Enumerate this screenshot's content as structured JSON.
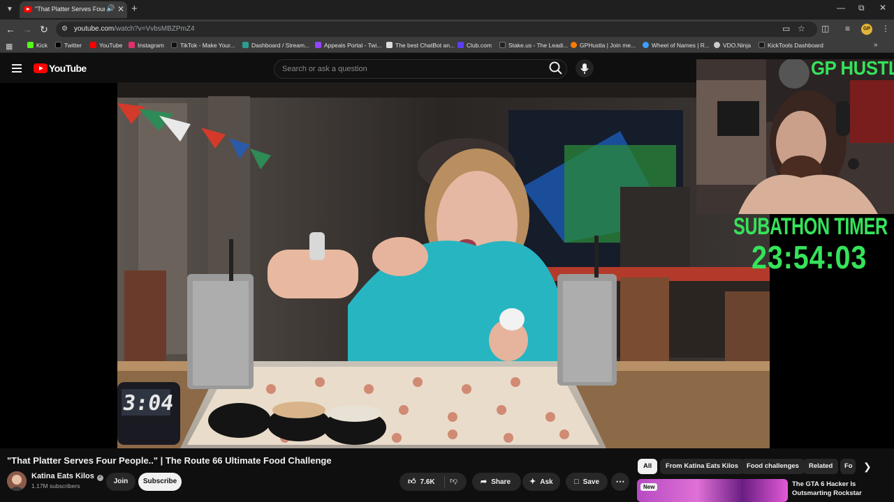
{
  "browser": {
    "tab_title": "\"That Platter Serves Four Pe",
    "url_host": "youtube.com",
    "url_path": "/watch?v=VvbsMBZPmZ4",
    "profile_initials": "GP",
    "bookmarks": [
      {
        "label": "Kick",
        "color": "#53fc18"
      },
      {
        "label": "Twitter",
        "color": "#000000"
      },
      {
        "label": "YouTube",
        "color": "#ff0000"
      },
      {
        "label": "Instagram",
        "color": "#e1306c"
      },
      {
        "label": "TikTok - Make Your...",
        "color": "#111111"
      },
      {
        "label": "Dashboard / Stream...",
        "color": "#2a9d8f"
      },
      {
        "label": "Appeals Portal - Twi...",
        "color": "#9146ff"
      },
      {
        "label": "The best ChatBot an...",
        "color": "#dddddd"
      },
      {
        "label": "Club.com",
        "color": "#5b3df5"
      },
      {
        "label": "Stake.us - The Leadi...",
        "color": "#222222"
      },
      {
        "label": "GPHustla | Join me...",
        "color": "#ff7a00"
      },
      {
        "label": "Wheel of Names | R...",
        "color": "#3aa0ff"
      },
      {
        "label": "VDO.Ninja",
        "color": "#cccccc"
      },
      {
        "label": "KickTools Dashboard",
        "color": "#1a1a1a"
      }
    ]
  },
  "youtube": {
    "logo_text": "YouTube",
    "search_placeholder": "Search or ask a question"
  },
  "overlay": {
    "streamer_name": "GP HUSTLA",
    "subathon_label": "SUBATHON TIMER",
    "subathon_time": "23:54:03"
  },
  "video": {
    "title": "\"That Platter Serves Four People..\" | The Route 66 Ultimate Food Challenge",
    "channel_name": "Katina Eats Kilos",
    "subscribers": "1.17M subscribers",
    "join_label": "Join",
    "subscribe_label": "Subscribe",
    "likes": "7.6K",
    "share_label": "Share",
    "ask_label": "Ask",
    "save_label": "Save",
    "timer_display": "3:04"
  },
  "recommendations": {
    "chips": [
      "All",
      "From Katina Eats Kilos",
      "Food challenges",
      "Related",
      "Fo"
    ],
    "items": [
      {
        "badge": "New",
        "title": "The GTA 6 Hacker Is Outsmarting Rockstar"
      }
    ]
  }
}
